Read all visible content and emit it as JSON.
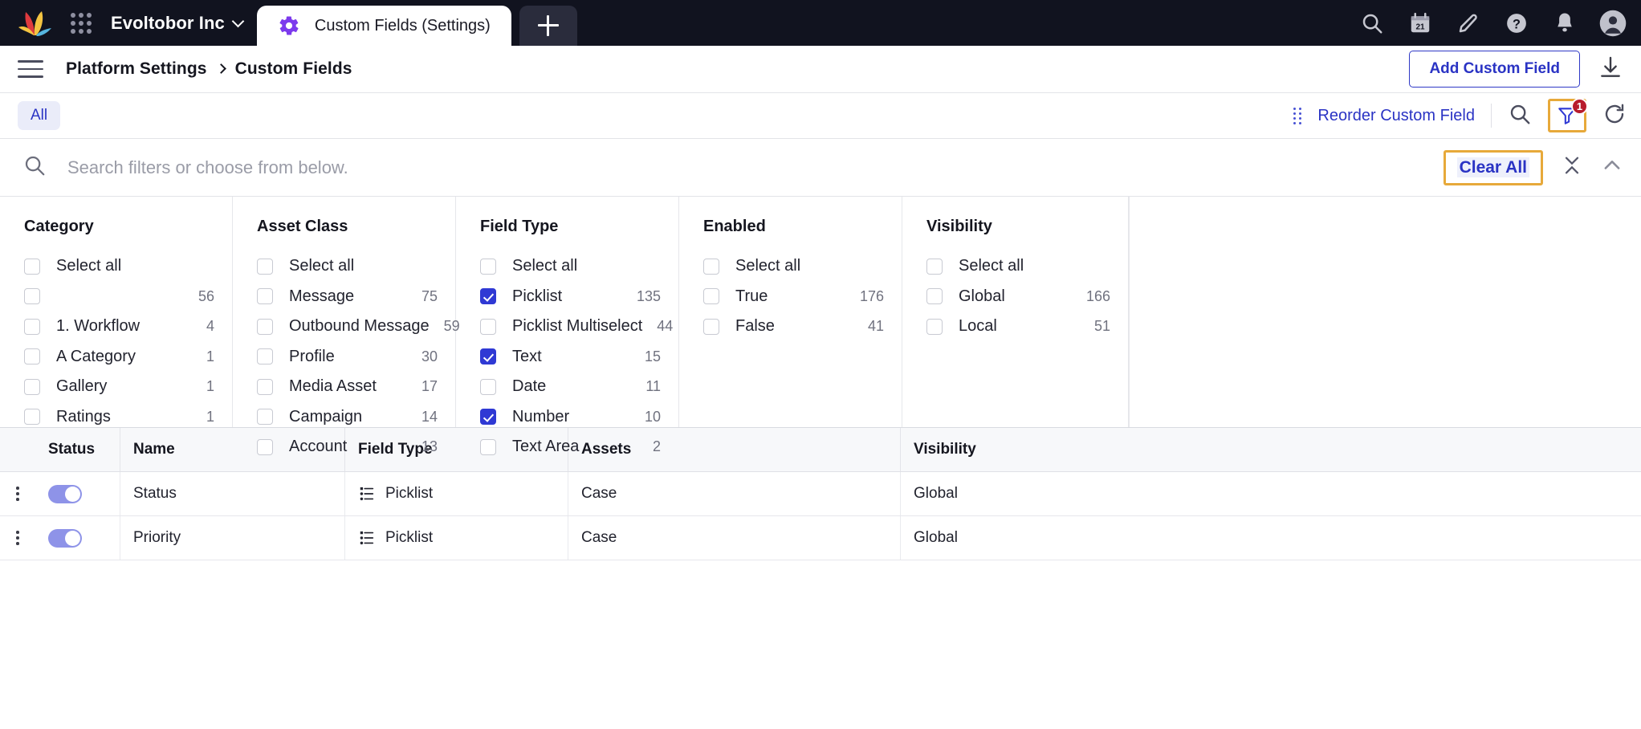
{
  "topbar": {
    "org_name": "Evoltobor Inc",
    "apps_icon": "apps-grid-icon",
    "tab": {
      "label": "Custom Fields (Settings)",
      "icon": "gear-icon"
    },
    "new_tab_label": "+",
    "actions": [
      {
        "name": "search-icon"
      },
      {
        "name": "calendar-icon",
        "day": "21"
      },
      {
        "name": "pencil-icon"
      },
      {
        "name": "help-icon"
      },
      {
        "name": "bell-icon"
      },
      {
        "name": "avatar-icon"
      }
    ]
  },
  "breadcrumb": {
    "parent": "Platform Settings",
    "current": "Custom Fields",
    "add_button": "Add Custom Field",
    "download_icon": "download-icon"
  },
  "toolbar": {
    "all_tab": "All",
    "reorder_link": "Reorder Custom Field",
    "search_icon": "search-icon",
    "filter_icon": "filter-icon",
    "filter_badge": "1",
    "refresh_icon": "refresh-icon"
  },
  "filter_search": {
    "placeholder": "Search filters or choose from below.",
    "value": "",
    "clear_all": "Clear All",
    "collapse_icon": "collapse-icon",
    "chevron_up_icon": "chevron-up-icon"
  },
  "filter_panel": {
    "columns": [
      {
        "title": "Category",
        "select_all": "Select all",
        "options": [
          {
            "label": "",
            "count": "56",
            "checked": false
          },
          {
            "label": "1. Workflow",
            "count": "4",
            "checked": false
          },
          {
            "label": "A Category",
            "count": "1",
            "checked": false
          },
          {
            "label": "Gallery",
            "count": "1",
            "checked": false
          },
          {
            "label": "Ratings",
            "count": "1",
            "checked": false
          }
        ]
      },
      {
        "title": "Asset Class",
        "select_all": "Select all",
        "options": [
          {
            "label": "Message",
            "count": "75",
            "checked": false
          },
          {
            "label": "Outbound Message",
            "count": "59",
            "checked": false
          },
          {
            "label": "Profile",
            "count": "30",
            "checked": false
          },
          {
            "label": "Media Asset",
            "count": "17",
            "checked": false
          },
          {
            "label": "Campaign",
            "count": "14",
            "checked": false
          },
          {
            "label": "Account",
            "count": "13",
            "checked": false
          }
        ]
      },
      {
        "title": "Field Type",
        "select_all": "Select all",
        "options": [
          {
            "label": "Picklist",
            "count": "135",
            "checked": true
          },
          {
            "label": "Picklist Multiselect",
            "count": "44",
            "checked": false
          },
          {
            "label": "Text",
            "count": "15",
            "checked": true
          },
          {
            "label": "Date",
            "count": "11",
            "checked": false
          },
          {
            "label": "Number",
            "count": "10",
            "checked": true
          },
          {
            "label": "Text Area",
            "count": "2",
            "checked": false
          }
        ]
      },
      {
        "title": "Enabled",
        "select_all": "Select all",
        "options": [
          {
            "label": "True",
            "count": "176",
            "checked": false
          },
          {
            "label": "False",
            "count": "41",
            "checked": false
          }
        ]
      },
      {
        "title": "Visibility",
        "select_all": "Select all",
        "options": [
          {
            "label": "Global",
            "count": "166",
            "checked": false
          },
          {
            "label": "Local",
            "count": "51",
            "checked": false
          }
        ]
      }
    ]
  },
  "table": {
    "headers": [
      "Status",
      "Name",
      "Field Type",
      "Assets",
      "Visibility"
    ],
    "rows": [
      {
        "enabled": true,
        "name": "Status",
        "field_type": "Picklist",
        "assets": "Case",
        "visibility": "Global"
      },
      {
        "enabled": true,
        "name": "Priority",
        "field_type": "Picklist",
        "assets": "Case",
        "visibility": "Global"
      }
    ]
  },
  "colors": {
    "accent_blue": "#2a33c4",
    "checkbox_blue": "#2f39d4",
    "highlight_orange": "#e7a93a",
    "badge_red": "#b81b2c",
    "topbar_dark": "#11131f"
  }
}
